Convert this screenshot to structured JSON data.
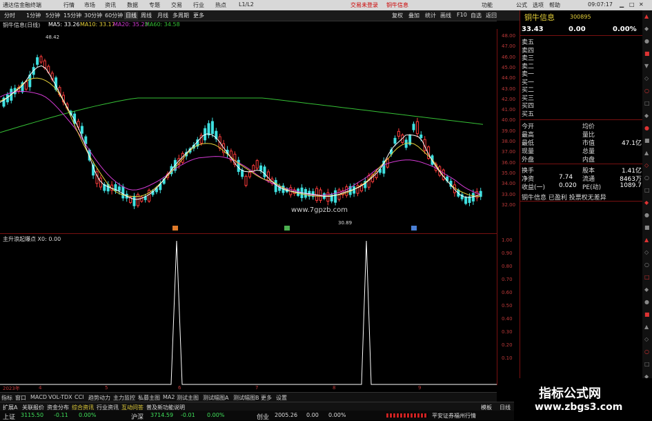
{
  "window": {
    "title": "通达信金融终端",
    "trade_login": "交易未登录",
    "stock_tab": "铜牛信息",
    "right_menu": [
      "功能",
      "公式",
      "选项",
      "帮助"
    ],
    "clock": "09:07:17"
  },
  "menu": [
    "分时",
    "1分钟",
    "5分钟",
    "15分钟",
    "30分钟",
    "60分钟",
    "日线",
    "周线",
    "月线",
    "多周期",
    "更多"
  ],
  "top_menu": [
    "行情",
    "市场",
    "资讯",
    "数据",
    "专题",
    "交易",
    "行业",
    "热点",
    "L1/L2"
  ],
  "toolbar": [
    "复权",
    "叠加",
    "统计",
    "画线",
    "F10",
    "自选",
    "返回"
  ],
  "chart_info": {
    "name": "铜牛信息(日线)",
    "ma5": "MA5: 33.26",
    "ma10": "MA10: 33.17",
    "ma20": "MA20: 35.23",
    "ma60": "MA60: 34.58",
    "high_label": "48.42",
    "low_label": "30.89",
    "watermark": "www.7gpzb.com"
  },
  "price_axis": [
    "48.00",
    "47.00",
    "46.00",
    "45.00",
    "44.00",
    "43.00",
    "42.00",
    "41.00",
    "40.00",
    "39.00",
    "38.00",
    "37.00",
    "36.00",
    "35.00",
    "34.00",
    "33.00",
    "32.00"
  ],
  "sub_chart": {
    "title": "主升浪起爆点 X0: 0.00",
    "axis": [
      "1.00",
      "0.90",
      "0.80",
      "0.70",
      "0.60",
      "0.50",
      "0.40",
      "0.30",
      "0.20",
      "0.10"
    ]
  },
  "date_axis": [
    "2023年",
    "4",
    "5",
    "6",
    "7",
    "8",
    "9"
  ],
  "bottom_tabs": [
    "指标",
    "窗口",
    "MACD",
    "VOL-TDX",
    "CCI",
    "趋势动力",
    "主力监控",
    "私募主图",
    "MA2",
    "测试主图",
    "测试幅图A",
    "测试幅图B",
    "更多",
    "设置"
  ],
  "right_panel": {
    "stock_name": "铜牛信息",
    "stock_code": "300895",
    "price": "33.43",
    "change": "0.00",
    "change_pct": "0.00%",
    "order_rows": [
      "卖五",
      "卖四",
      "卖三",
      "卖二",
      "卖一",
      "买一",
      "买二",
      "买三",
      "买四",
      "买五"
    ],
    "stats": [
      {
        "l": "今开",
        "r": "均价",
        "v": ""
      },
      {
        "l": "最高",
        "r": "量比",
        "v": ""
      },
      {
        "l": "最低",
        "r": "市值",
        "v": "47.1亿"
      },
      {
        "l": "现量",
        "r": "总量",
        "v": ""
      },
      {
        "l": "外盘",
        "r": "内盘",
        "v": ""
      }
    ],
    "fin": [
      {
        "l": "换手",
        "lv": "",
        "r": "股本",
        "rv": "1.41亿"
      },
      {
        "l": "净资",
        "lv": "7.74",
        "r": "流通",
        "rv": "8463万"
      },
      {
        "l": "收益(一)",
        "lv": "0.020",
        "r": "PE(动)",
        "rv": "1089.7"
      }
    ],
    "note": "铜牛信息 已盈利 投票权无差异"
  },
  "status_bar": {
    "items": [
      "扩展A",
      "关联报价",
      "资金分布",
      "综合资讯",
      "行业资讯",
      "互动问答",
      "普及新功能说明"
    ],
    "right": "日线",
    "right2": "模板"
  },
  "index_bar": {
    "sh_name": "上证",
    "sh_val": "3115.50",
    "sh_chg": "-0.11",
    "sh_pct": "0.00%",
    "hs_name": "沪深",
    "hs_val": "3714.59",
    "hs_chg": "-0.01",
    "hs_pct": "0.00%",
    "cy_name": "创业",
    "cy_val": "2005.26",
    "cy_chg": "0.00",
    "cy_pct": "0.00%",
    "broker": "平安证券福州行情"
  },
  "bottom_watermark": {
    "line1": "指标公式网",
    "line2": "www.zbgs3.com"
  },
  "colors": {
    "up": "#ff3b3b",
    "down": "#3fe0e0",
    "ma5": "#ffffff",
    "ma10": "#e6d13a",
    "ma20": "#d43ad4",
    "ma60": "#36c236",
    "axis": "#bd3a3a"
  }
}
